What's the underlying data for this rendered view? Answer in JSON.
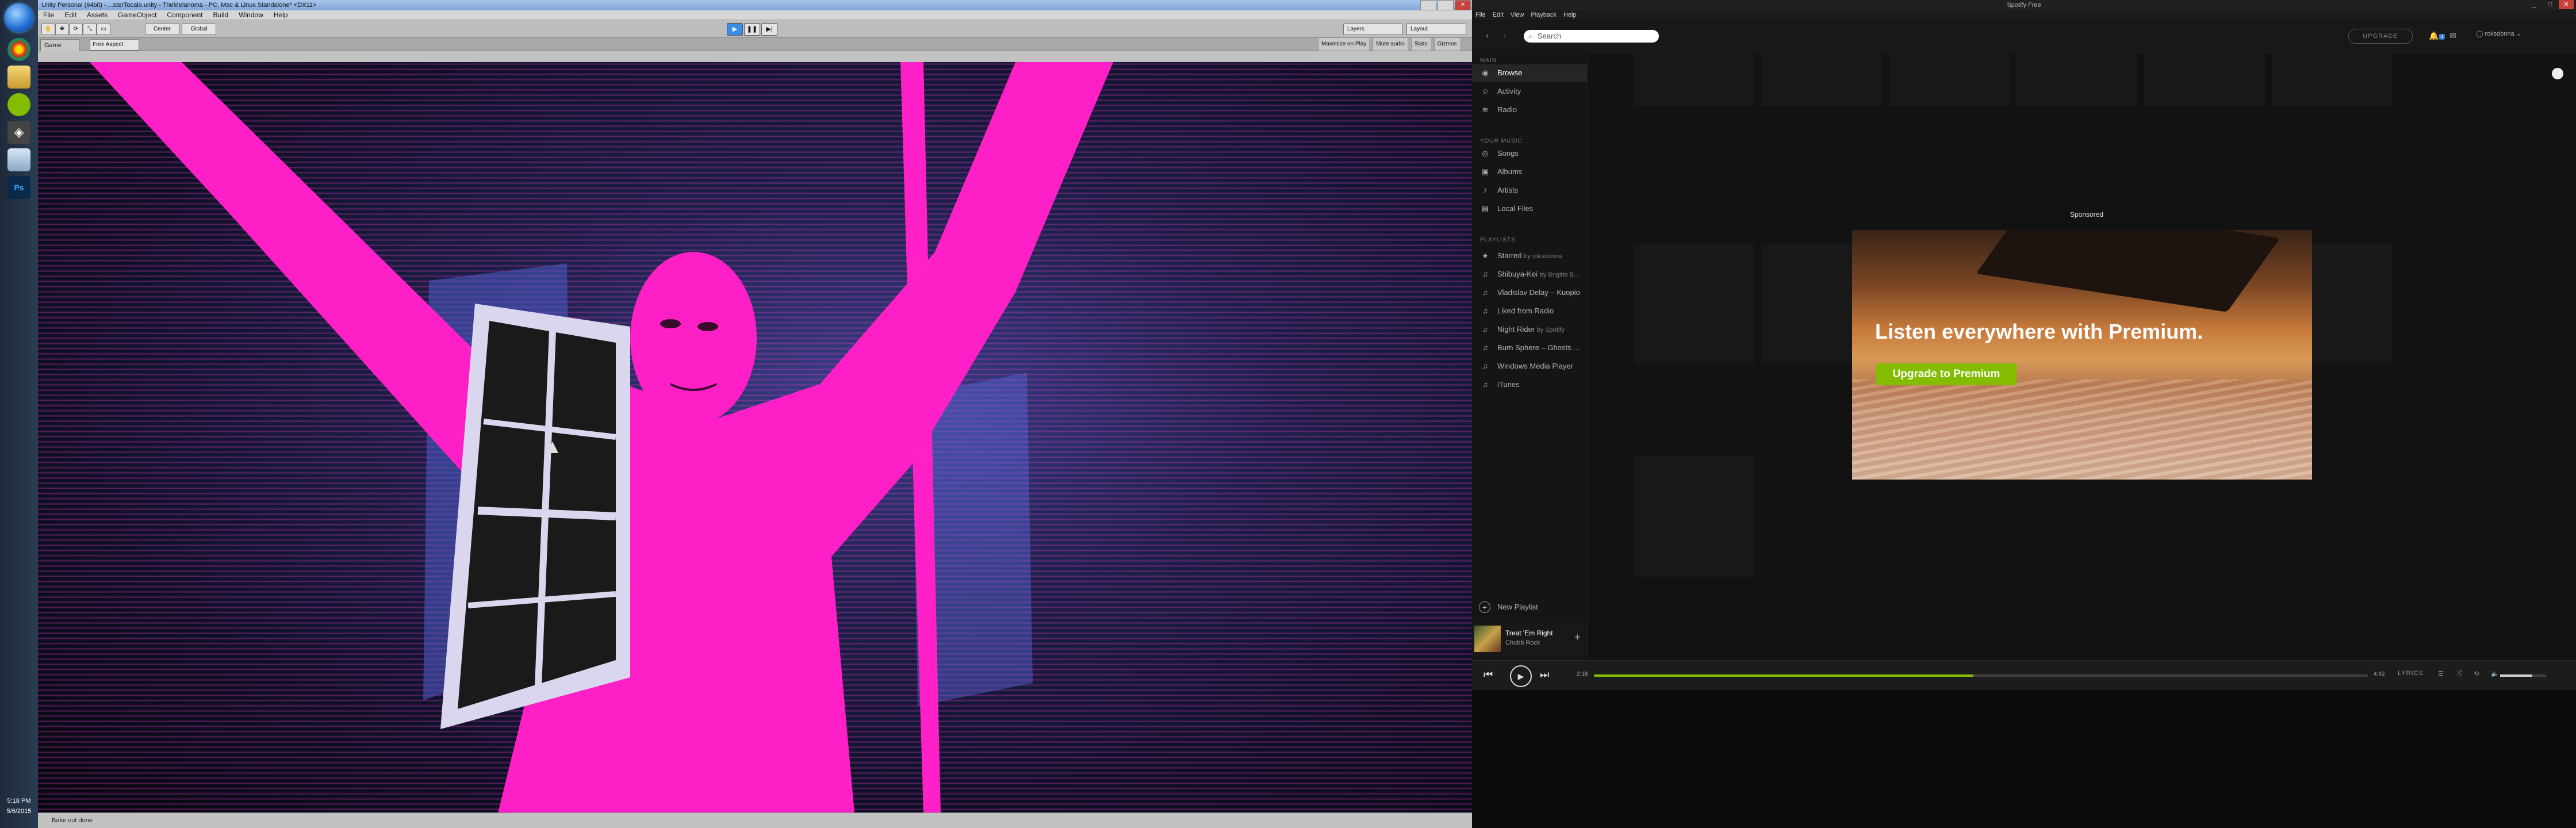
{
  "taskbar": {
    "time": "5:18 PM",
    "date": "5/6/2015",
    "apps": [
      "chrome-icon",
      "explorer-icon",
      "spotify-icon",
      "unity-icon",
      "notepad-icon",
      "photoshop-icon"
    ]
  },
  "unity": {
    "title": "Unity Personal (64bit) - ...sterTocalo.unity - TheMelanoma - PC, Mac & Linux Standalone* <DX11>",
    "menu": [
      "File",
      "Edit",
      "Assets",
      "GameObject",
      "Component",
      "Build",
      "Window",
      "Help"
    ],
    "toolbar": {
      "center": "Center",
      "global": "Global",
      "layers": "Layers",
      "layout": "Layout"
    },
    "tab": "Game",
    "aspect": "Free Aspect",
    "game_options": [
      "Maximize on Play",
      "Mute audio",
      "Stats",
      "Gizmos"
    ],
    "status": "Bake out done"
  },
  "spotify": {
    "title": "Spotify Free",
    "menu": [
      "File",
      "Edit",
      "View",
      "Playback",
      "Help"
    ],
    "search_placeholder": "Search",
    "upgrade_label": "UPGRADE",
    "notifications": "4",
    "username": "roksdonna",
    "sections": {
      "main": "MAIN",
      "your_music": "YOUR MUSIC",
      "playlists": "PLAYLISTS"
    },
    "main_items": [
      {
        "label": "Browse",
        "icon": "browse-icon"
      },
      {
        "label": "Activity",
        "icon": "activity-icon"
      },
      {
        "label": "Radio",
        "icon": "radio-icon"
      }
    ],
    "music_items": [
      {
        "label": "Songs",
        "icon": "songs-icon"
      },
      {
        "label": "Albums",
        "icon": "albums-icon"
      },
      {
        "label": "Artists",
        "icon": "artists-icon"
      },
      {
        "label": "Local Files",
        "icon": "local-files-icon"
      }
    ],
    "playlists": [
      {
        "label": "Starred",
        "sub": "by roksdonna",
        "icon": "star-icon"
      },
      {
        "label": "Shibuya-Kei",
        "sub": "by Brigitte B...",
        "icon": "playlist-icon"
      },
      {
        "label": "Vladislav Delay – Kuopio",
        "sub": "",
        "icon": "playlist-icon"
      },
      {
        "label": "Liked from Radio",
        "sub": "",
        "icon": "playlist-icon"
      },
      {
        "label": "Night Rider",
        "sub": "by Spotify",
        "icon": "playlist-icon"
      },
      {
        "label": "Burn Sphere – Ghosts ...",
        "sub": "",
        "icon": "playlist-icon"
      },
      {
        "label": "Windows Media Player",
        "sub": "",
        "icon": "playlist-icon"
      },
      {
        "label": "iTunes",
        "sub": "",
        "icon": "playlist-icon"
      }
    ],
    "new_playlist": "New Playlist",
    "now_playing": {
      "title": "Treat 'Em Right",
      "artist": "Chubb Rock"
    },
    "ad": {
      "sponsored": "Sponsored",
      "headline": "Listen everywhere with Premium.",
      "button": "Upgrade to Premium"
    },
    "player": {
      "elapsed": "2:18",
      "duration": "4:42",
      "progress": 0.49,
      "lyrics": "LYRICS",
      "volume": 0.7
    }
  }
}
